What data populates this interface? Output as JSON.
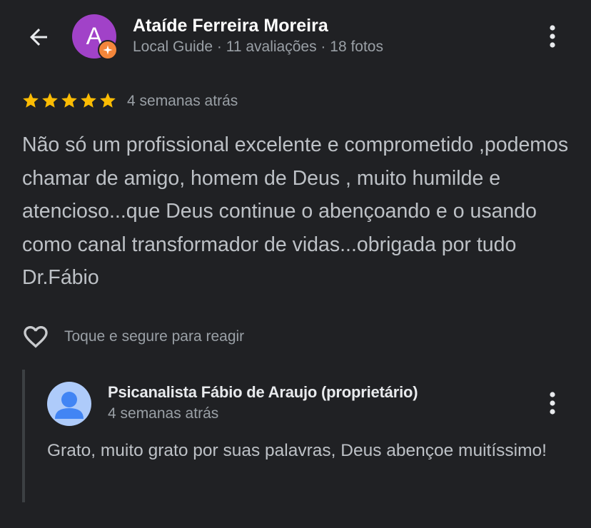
{
  "header": {
    "author_name": "Ataíde Ferreira Moreira",
    "avatar_letter": "A",
    "author_meta": "Local Guide · 11 avaliações · 18 fotos",
    "avatar_color": "#a142c8",
    "badge_color": "#f4863b",
    "icons": {
      "back": "arrow-left-icon",
      "more": "more-vert-icon",
      "badge": "local-guide-star-icon"
    }
  },
  "review": {
    "rating": 5,
    "star_color": "#fbbc04",
    "date": "4 semanas atrás",
    "text": "Não só um profissional excelente e comprometido ,podemos chamar de amigo, homem de Deus , muito humilde e atencioso...que Deus continue o abençoando e o usando como canal transformador de vidas...obrigada por tudo Dr.Fábio"
  },
  "reaction": {
    "label": "Toque e segure para reagir",
    "icon": "heart-outline-icon"
  },
  "owner_reply": {
    "name": "Psicanalista Fábio de Araujo (proprietário)",
    "date": "4 semanas atrás",
    "text": "Grato, muito grato por suas palavras, Deus abençoe muitíssimo!",
    "avatar_color": "#aecbfa",
    "icons": {
      "avatar": "default-person-icon",
      "more": "more-vert-icon"
    }
  }
}
